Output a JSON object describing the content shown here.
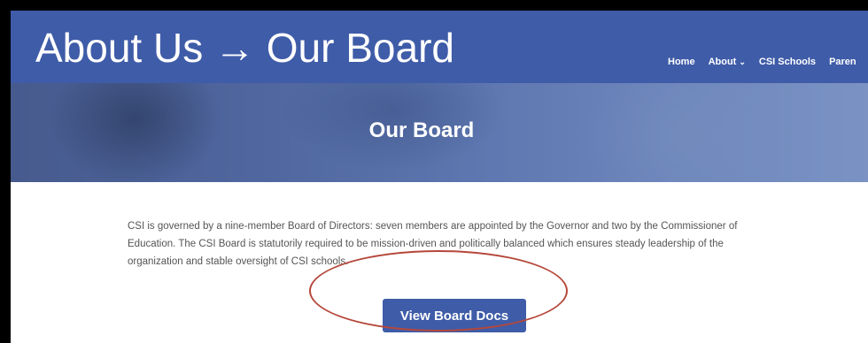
{
  "title_overlay": "About Us → Our Board",
  "nav": {
    "home": "Home",
    "about": "About",
    "about_chevron": "⌄",
    "csi_schools": "CSI Schools",
    "parents": "Paren"
  },
  "hero": {
    "title": "Our Board"
  },
  "main": {
    "paragraph": "CSI is governed by a nine-member Board of Directors: seven members are appointed by the Governor and two by the Commissioner of Education. The CSI Board is statutorily required to be mission-driven and politically balanced which ensures steady leadership of the organization and stable oversight of CSI schools.",
    "button_label": "View Board Docs"
  },
  "colors": {
    "brand_blue": "#3f5ca8",
    "annotation_circle": "#b5473a"
  }
}
